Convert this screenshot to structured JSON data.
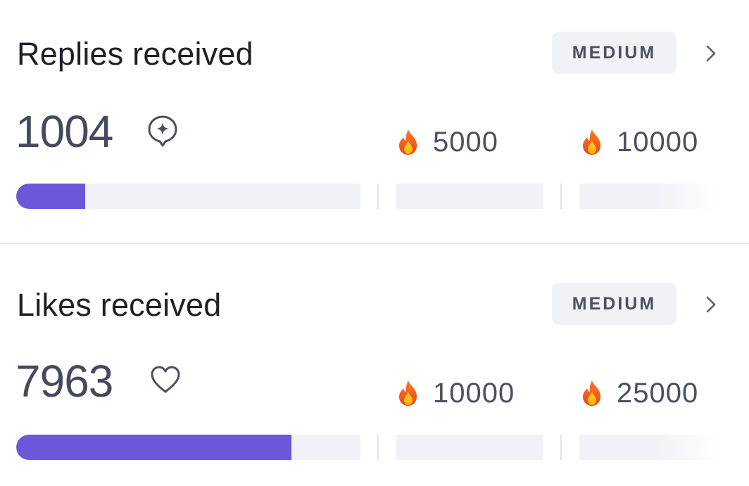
{
  "cards": [
    {
      "title": "Replies received",
      "level": "MEDIUM",
      "count": "1004",
      "count_icon": "sparkle-pin-icon",
      "progress_fraction": 0.2,
      "milestones": [
        {
          "icon": "fire-icon",
          "value": "5000"
        },
        {
          "icon": "fire-icon",
          "value": "10000"
        }
      ]
    },
    {
      "title": "Likes received",
      "level": "MEDIUM",
      "count": "7963",
      "count_icon": "heart-icon",
      "progress_fraction": 0.8,
      "milestones": [
        {
          "icon": "fire-icon",
          "value": "10000"
        },
        {
          "icon": "fire-icon",
          "value": "25000"
        }
      ]
    }
  ],
  "colors": {
    "progress_fill": "#6b57d9",
    "track": "#f1f2f7",
    "badge_bg": "#f1f2f6"
  }
}
